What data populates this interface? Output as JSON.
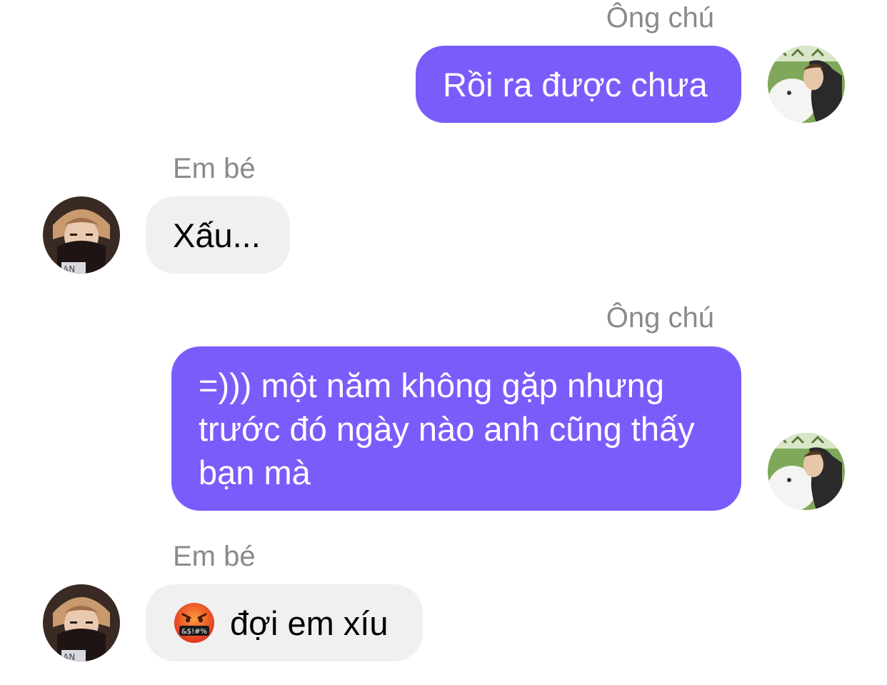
{
  "messages": [
    {
      "sender": "Ông chú",
      "direction": "outgoing",
      "text": "Rồi ra được chưa"
    },
    {
      "sender": "Em bé",
      "direction": "incoming",
      "text": "Xấu..."
    },
    {
      "sender": "Ông chú",
      "direction": "outgoing",
      "text": "=))) một năm không gặp nhưng trước đó ngày nào anh cũng thấy bạn mà"
    },
    {
      "sender": "Em bé",
      "direction": "incoming",
      "emoji": "face-with-symbols-on-mouth",
      "text": "đợi em xíu"
    }
  ],
  "colors": {
    "outgoing_bubble": "#7b5cfb",
    "incoming_bubble": "#f0f0f0",
    "sender_name": "#8a8a8e"
  }
}
